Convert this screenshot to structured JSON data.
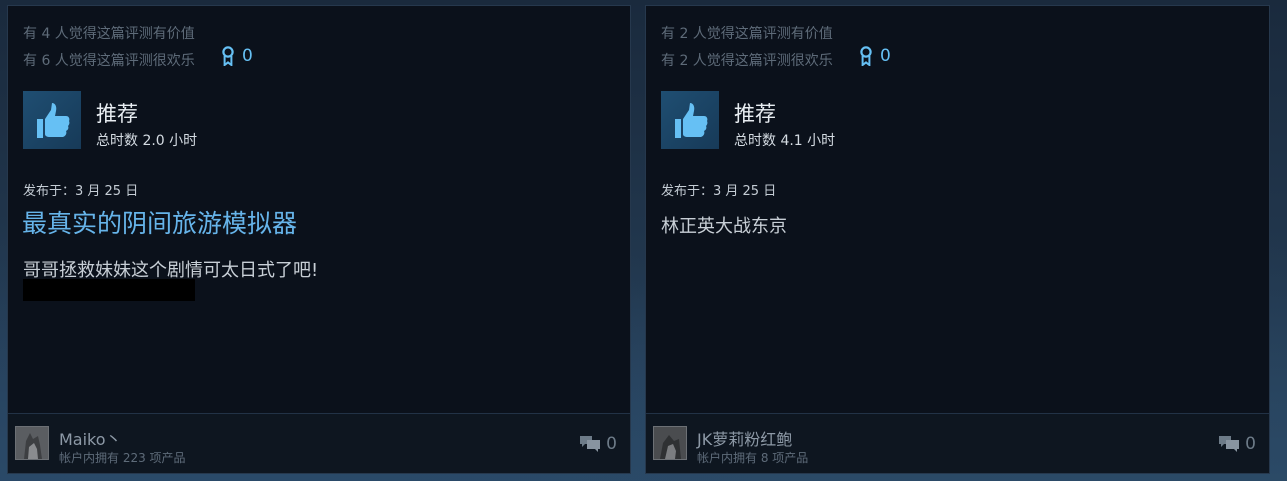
{
  "reviews": [
    {
      "helpful_text": "有 4 人觉得这篇评测有价值",
      "funny_text": "有 6 人觉得这篇评测很欢乐",
      "award_count": "0",
      "recommendation": "推荐",
      "hours": "总时数 2.0 小时",
      "posted": "发布于：3 月 25 日",
      "title": "最真实的阴间旅游模拟器",
      "body": "哥哥拯救妹妹这个剧情可太日式了吧!",
      "has_spoiler": true,
      "author": "Maiko丶",
      "products": "帐户内拥有 223 项产品",
      "comment_count": "0"
    },
    {
      "helpful_text": "有 2 人觉得这篇评测有价值",
      "funny_text": "有 2 人觉得这篇评测很欢乐",
      "award_count": "0",
      "recommendation": "推荐",
      "hours": "总时数 4.1 小时",
      "posted": "发布于：3 月 25 日",
      "body": "林正英大战东京",
      "author": "JK萝莉粉红鲍",
      "products": "帐户内拥有 8 项产品",
      "comment_count": "0"
    }
  ],
  "icons": {
    "award": "award-ribbon-icon",
    "thumb": "thumbs-up-icon",
    "comment": "comment-bubbles-icon"
  },
  "colors": {
    "accent": "#66c0f4",
    "card_bg": "#0b111b",
    "title_blue": "#66b4ea"
  }
}
